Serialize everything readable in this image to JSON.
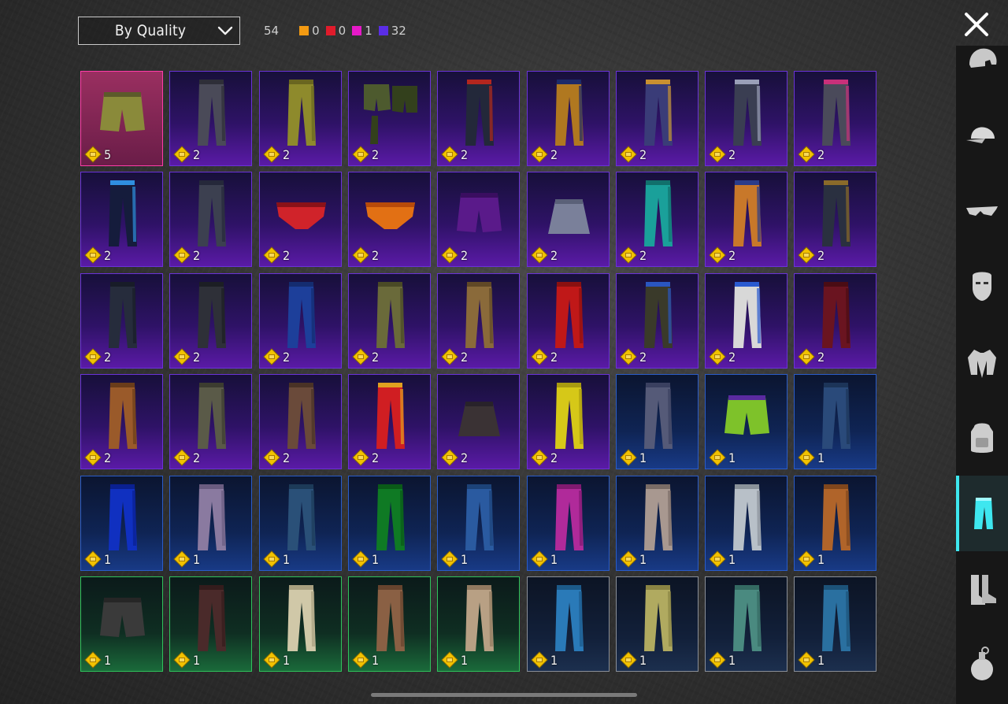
{
  "filter": {
    "label": "By Quality"
  },
  "counts": {
    "total": "54",
    "legendary": {
      "value": "0",
      "color": "#f39a12"
    },
    "red": {
      "value": "0",
      "color": "#e01b2b"
    },
    "mythic": {
      "value": "1",
      "color": "#e619c8"
    },
    "epic": {
      "value": "32",
      "color": "#5a2de6"
    }
  },
  "sidebar": [
    {
      "icon": "helmet-icon"
    },
    {
      "icon": "cap-icon"
    },
    {
      "icon": "glasses-icon"
    },
    {
      "icon": "mask-icon"
    },
    {
      "icon": "jacket-icon"
    },
    {
      "icon": "backpack-icon"
    },
    {
      "icon": "pants-icon",
      "active": true
    },
    {
      "icon": "boots-icon"
    },
    {
      "icon": "grenade-icon"
    }
  ],
  "items": [
    {
      "rarity": "mythic",
      "count": "5",
      "kind": "shorts",
      "color": "#8a8a3a",
      "color2": "#5c5a2a"
    },
    {
      "rarity": "epic",
      "count": "2",
      "kind": "pants",
      "color": "#4a4a58",
      "color2": "#2e2e38"
    },
    {
      "rarity": "epic",
      "count": "2",
      "kind": "pants",
      "color": "#8e8a2c",
      "color2": "#6a6620"
    },
    {
      "rarity": "epic",
      "count": "2",
      "kind": "shorts2",
      "color": "#4d5a2e",
      "color2": "#33401c"
    },
    {
      "rarity": "epic",
      "count": "2",
      "kind": "pants",
      "color": "#23283a",
      "color2": "#b3261e"
    },
    {
      "rarity": "epic",
      "count": "2",
      "kind": "pants",
      "color": "#b07820",
      "color2": "#1c2a6a"
    },
    {
      "rarity": "epic",
      "count": "2",
      "kind": "pants",
      "color": "#3a3c78",
      "color2": "#c89030"
    },
    {
      "rarity": "epic",
      "count": "2",
      "kind": "pants",
      "color": "#3a3e52",
      "color2": "#9aa0b8"
    },
    {
      "rarity": "epic",
      "count": "2",
      "kind": "pants",
      "color": "#4a4a5a",
      "color2": "#c8307a"
    },
    {
      "rarity": "epic",
      "count": "2",
      "kind": "pants",
      "color": "#151c3c",
      "color2": "#2f8fe0"
    },
    {
      "rarity": "epic",
      "count": "2",
      "kind": "pants",
      "color": "#3c4050",
      "color2": "#25283a"
    },
    {
      "rarity": "epic",
      "count": "2",
      "kind": "briefs",
      "color": "#d0232a",
      "color2": "#8a1218"
    },
    {
      "rarity": "epic",
      "count": "2",
      "kind": "briefs",
      "color": "#e27014",
      "color2": "#b84a0a"
    },
    {
      "rarity": "epic",
      "count": "2",
      "kind": "shorts",
      "color": "#5a1a8a",
      "color2": "#3a0e60"
    },
    {
      "rarity": "epic",
      "count": "2",
      "kind": "skirt",
      "color": "#7a809a",
      "color2": "#5a6078"
    },
    {
      "rarity": "epic",
      "count": "2",
      "kind": "pants",
      "color": "#1aa09a",
      "color2": "#11706c"
    },
    {
      "rarity": "epic",
      "count": "2",
      "kind": "pants",
      "color": "#c8782a",
      "color2": "#2a3c8a"
    },
    {
      "rarity": "epic",
      "count": "2",
      "kind": "pants",
      "color": "#2a3040",
      "color2": "#8a6a2a"
    },
    {
      "rarity": "epic",
      "count": "2",
      "kind": "pants",
      "color": "#262c3c",
      "color2": "#181c28"
    },
    {
      "rarity": "epic",
      "count": "2",
      "kind": "pants",
      "color": "#2e3038",
      "color2": "#1c1e24"
    },
    {
      "rarity": "epic",
      "count": "2",
      "kind": "pants",
      "color": "#1d3f9a",
      "color2": "#142c70"
    },
    {
      "rarity": "epic",
      "count": "2",
      "kind": "pants",
      "color": "#6a6a3a",
      "color2": "#4a4a26"
    },
    {
      "rarity": "epic",
      "count": "2",
      "kind": "pants",
      "color": "#8a6a3a",
      "color2": "#604826"
    },
    {
      "rarity": "epic",
      "count": "2",
      "kind": "pants",
      "color": "#c01818",
      "color2": "#8a1010"
    },
    {
      "rarity": "epic",
      "count": "2",
      "kind": "pants",
      "color": "#3a3a2a",
      "color2": "#2a56c0"
    },
    {
      "rarity": "epic",
      "count": "2",
      "kind": "pants",
      "color": "#d8d8d8",
      "color2": "#2a5ad0"
    },
    {
      "rarity": "epic",
      "count": "2",
      "kind": "pants",
      "color": "#6a1420",
      "color2": "#4a0c14"
    },
    {
      "rarity": "epic",
      "count": "2",
      "kind": "pants",
      "color": "#9a5a2a",
      "color2": "#6a3c1a"
    },
    {
      "rarity": "epic",
      "count": "2",
      "kind": "pants",
      "color": "#5a5a48",
      "color2": "#3c3c30"
    },
    {
      "rarity": "epic",
      "count": "2",
      "kind": "pants",
      "color": "#6a4a3a",
      "color2": "#4a3226"
    },
    {
      "rarity": "epic",
      "count": "2",
      "kind": "pants",
      "color": "#d01e22",
      "color2": "#e0a020"
    },
    {
      "rarity": "epic",
      "count": "2",
      "kind": "skirt",
      "color": "#3a3234",
      "color2": "#28222a"
    },
    {
      "rarity": "epic",
      "count": "2",
      "kind": "pants",
      "color": "#d6c818",
      "color2": "#a89a10"
    },
    {
      "rarity": "rare",
      "count": "1",
      "kind": "pants",
      "color": "#555a78",
      "color2": "#3a4060"
    },
    {
      "rarity": "rare",
      "count": "1",
      "kind": "shorts",
      "color": "#7ec22a",
      "color2": "#5a2aa0"
    },
    {
      "rarity": "rare",
      "count": "1",
      "kind": "pants",
      "color": "#2a4a7a",
      "color2": "#1c3458"
    },
    {
      "rarity": "rare",
      "count": "1",
      "kind": "pants",
      "color": "#1030c0",
      "color2": "#0a2090"
    },
    {
      "rarity": "rare",
      "count": "1",
      "kind": "pants",
      "color": "#8a7aa0",
      "color2": "#6a5c80"
    },
    {
      "rarity": "rare",
      "count": "1",
      "kind": "pants",
      "color": "#2a5078",
      "color2": "#1c3a58"
    },
    {
      "rarity": "rare",
      "count": "1",
      "kind": "pants",
      "color": "#0f7a24",
      "color2": "#0a5a18"
    },
    {
      "rarity": "rare",
      "count": "1",
      "kind": "pants",
      "color": "#2a5aa0",
      "color2": "#1c4278"
    },
    {
      "rarity": "rare",
      "count": "1",
      "kind": "pants",
      "color": "#b02a9a",
      "color2": "#801a70"
    },
    {
      "rarity": "rare",
      "count": "1",
      "kind": "pants",
      "color": "#a89890",
      "color2": "#7a6c66"
    },
    {
      "rarity": "rare",
      "count": "1",
      "kind": "pants",
      "color": "#b8c0c8",
      "color2": "#8a929a"
    },
    {
      "rarity": "rare",
      "count": "1",
      "kind": "pants",
      "color": "#b0642a",
      "color2": "#80461c"
    },
    {
      "rarity": "uncommon",
      "count": "1",
      "kind": "shorts",
      "color": "#3a3a3a",
      "color2": "#262626"
    },
    {
      "rarity": "uncommon",
      "count": "1",
      "kind": "pants",
      "color": "#4a2a2a",
      "color2": "#341c1c"
    },
    {
      "rarity": "uncommon",
      "count": "1",
      "kind": "pants",
      "color": "#d0c8a8",
      "color2": "#a8a080"
    },
    {
      "rarity": "uncommon",
      "count": "1",
      "kind": "pants",
      "color": "#8a6044",
      "color2": "#66442e"
    },
    {
      "rarity": "uncommon",
      "count": "1",
      "kind": "pants",
      "color": "#b8a084",
      "color2": "#907a60"
    },
    {
      "rarity": "common",
      "count": "1",
      "kind": "pants",
      "color": "#2a7ab8",
      "color2": "#1c5a8a"
    },
    {
      "rarity": "common",
      "count": "1",
      "kind": "pants",
      "color": "#b0aa60",
      "color2": "#8a8444"
    },
    {
      "rarity": "common",
      "count": "1",
      "kind": "pants",
      "color": "#4a8a80",
      "color2": "#346a62"
    },
    {
      "rarity": "common",
      "count": "1",
      "kind": "pants",
      "color": "#2a70a0",
      "color2": "#1c5278"
    }
  ]
}
